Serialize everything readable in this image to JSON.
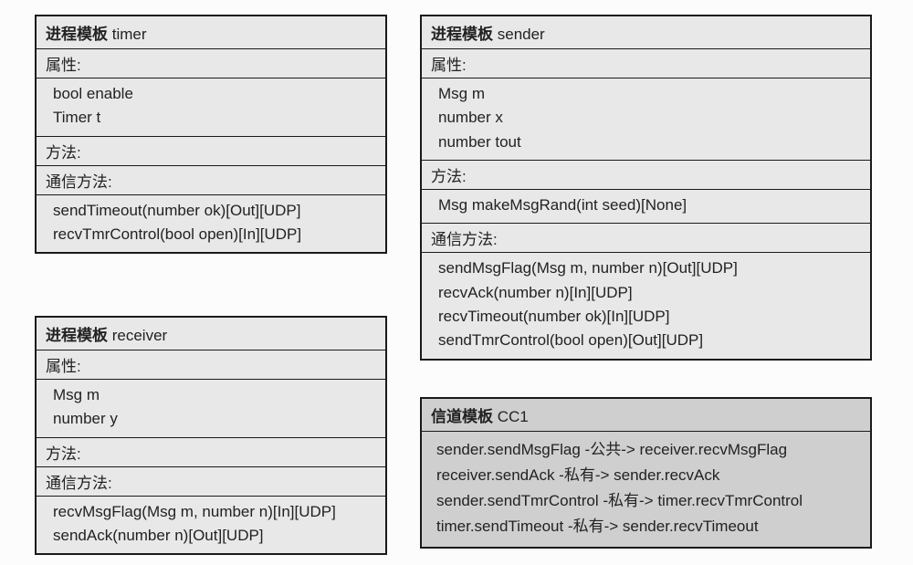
{
  "labels": {
    "process_template": "进程模板",
    "channel_template": "信道模板",
    "attributes": "属性:",
    "methods": "方法:",
    "comm_methods": "通信方法:"
  },
  "timer": {
    "name": "timer",
    "attrs": [
      "bool enable",
      "Timer t"
    ],
    "methods": [],
    "comm": [
      "sendTimeout(number ok)[Out][UDP]",
      "recvTmrControl(bool open)[In][UDP]"
    ]
  },
  "sender": {
    "name": "sender",
    "attrs": [
      "Msg m",
      "number x",
      "number tout"
    ],
    "methods": [
      "Msg makeMsgRand(int seed)[None]"
    ],
    "comm": [
      "sendMsgFlag(Msg m, number n)[Out][UDP]",
      "recvAck(number n)[In][UDP]",
      "recvTimeout(number ok)[In][UDP]",
      "sendTmrControl(bool open)[Out][UDP]"
    ]
  },
  "receiver": {
    "name": "receiver",
    "attrs": [
      "Msg m",
      "number y"
    ],
    "methods": [],
    "comm": [
      "recvMsgFlag(Msg m, number n)[In][UDP]",
      "sendAck(number n)[Out][UDP]"
    ]
  },
  "cc1": {
    "name": "CC1",
    "lines": [
      "sender.sendMsgFlag -公共-> receiver.recvMsgFlag",
      "receiver.sendAck -私有-> sender.recvAck",
      "sender.sendTmrControl -私有-> timer.recvTmrControl",
      "timer.sendTimeout -私有-> sender.recvTimeout"
    ]
  }
}
